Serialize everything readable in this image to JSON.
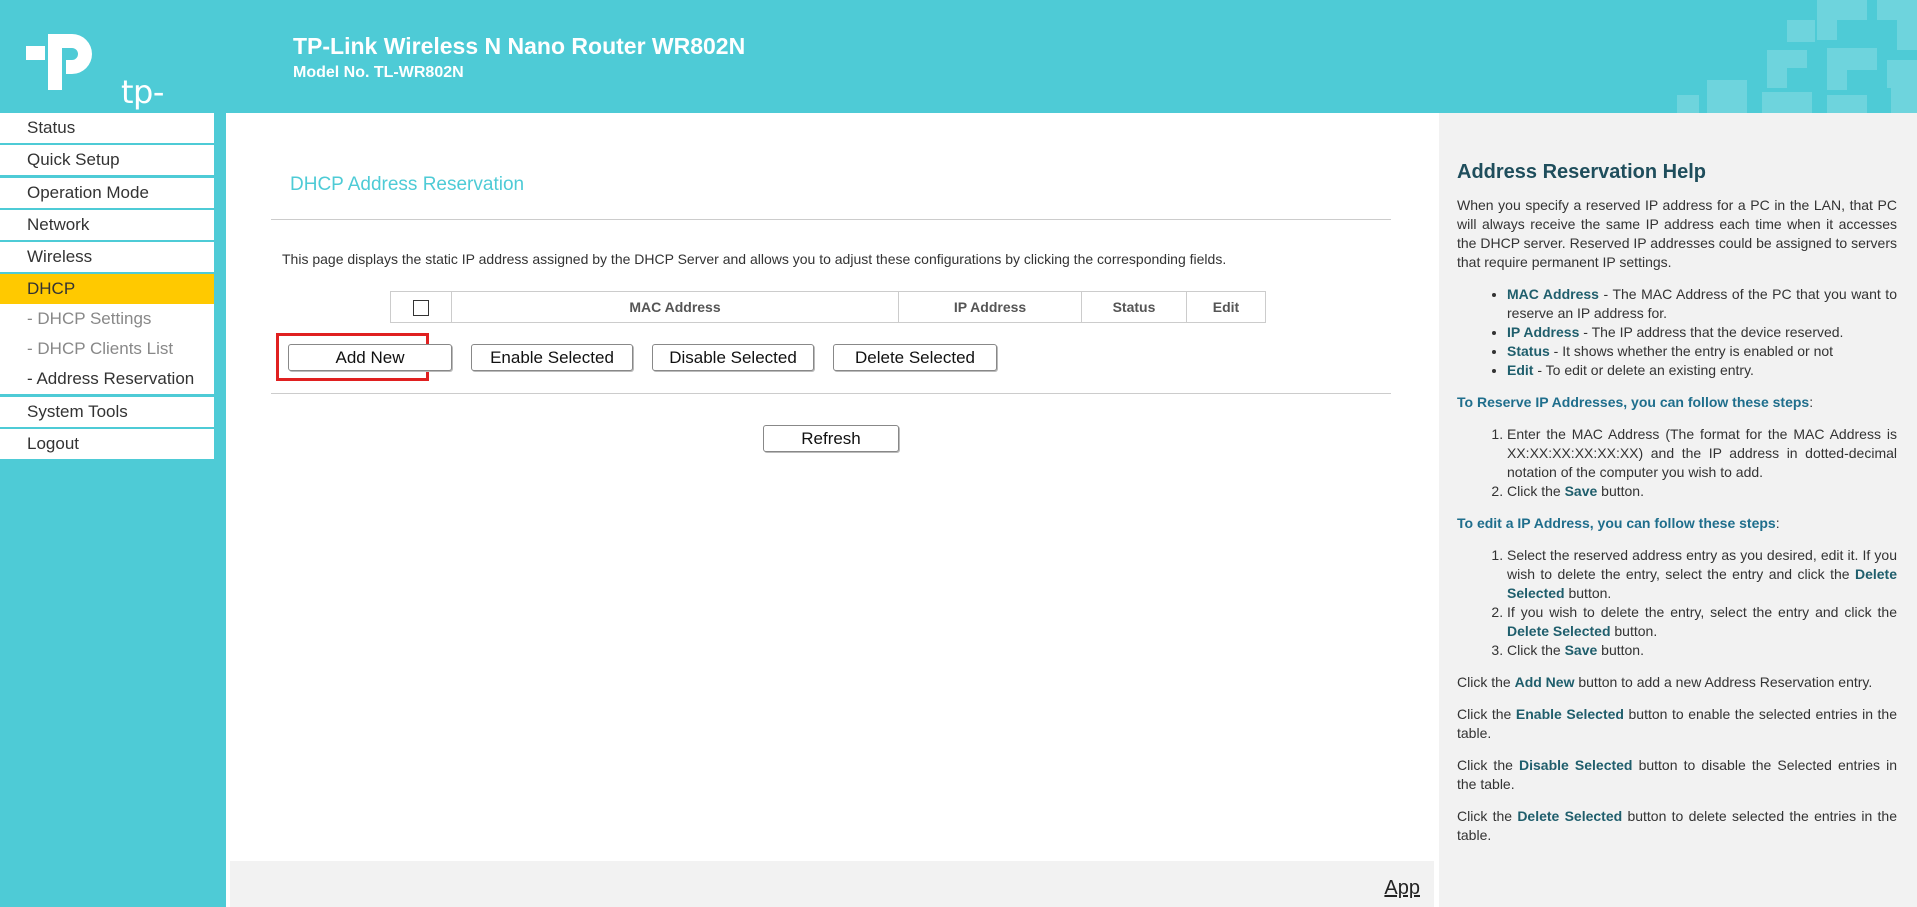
{
  "header": {
    "logo_text": "tp-link",
    "title": "TP-Link Wireless N Nano Router WR802N",
    "model": "Model No. TL-WR802N"
  },
  "menu": {
    "status": "Status",
    "quick_setup": "Quick Setup",
    "operation_mode": "Operation Mode",
    "network": "Network",
    "wireless": "Wireless",
    "dhcp": "DHCP",
    "dhcp_settings": "- DHCP Settings",
    "dhcp_clients_list": "- DHCP Clients List",
    "address_reservation": "- Address Reservation",
    "system_tools": "System Tools",
    "logout": "Logout"
  },
  "main": {
    "title": "DHCP Address Reservation",
    "description": "This page displays the static IP address assigned by the DHCP Server and allows you to adjust these configurations by clicking the corresponding fields.",
    "table_headers": {
      "mac": "MAC Address",
      "ip": "IP Address",
      "status": "Status",
      "edit": "Edit"
    },
    "buttons": {
      "add_new": "Add New",
      "enable_selected": "Enable Selected",
      "disable_selected": "Disable Selected",
      "delete_selected": "Delete Selected",
      "refresh": "Refresh"
    },
    "footer_link": "App"
  },
  "help": {
    "title": "Address Reservation Help",
    "intro": "When you specify a reserved IP address for a PC in the LAN, that PC will always receive the same IP address each time when it accesses the DHCP server. Reserved IP addresses could be assigned to servers that require permanent IP settings.",
    "fields": [
      {
        "term": "MAC Address",
        "text": " - The MAC Address of the PC that you want to reserve an IP address for."
      },
      {
        "term": "IP Address",
        "text": " - The IP address that the device reserved."
      },
      {
        "term": "Status",
        "text": " - It shows whether the entry is enabled or not"
      },
      {
        "term": "Edit",
        "text": " - To edit or delete an existing entry."
      }
    ],
    "reserve_heading": "To Reserve IP Addresses, you can follow these steps",
    "reserve_steps": {
      "step1": "Enter the MAC Address (The format for the MAC Address is XX:XX:XX:XX:XX:XX) and the IP address in dotted-decimal notation of the computer you wish to add.",
      "step2_pre": "Click the ",
      "step2_term": "Save",
      "step2_post": " button."
    },
    "edit_heading": "To edit a IP Address, you can follow these steps",
    "edit_steps": {
      "step1_pre": "Select the reserved address entry as you desired, edit it. If you wish to delete the entry, select the entry and click the ",
      "step1_term": "Delete Selected",
      "step1_post": " button.",
      "step2_pre": "If you wish to delete the entry, select the entry and click the ",
      "step2_term": "Delete Selected",
      "step2_post": " button.",
      "step3_pre": "Click the ",
      "step3_term": "Save",
      "step3_post": " button."
    },
    "colon": ":",
    "click_the": "Click the ",
    "add_term": "Add New",
    "add_post": " button to add a new Address Reservation entry.",
    "enable_term": "Enable Selected",
    "enable_post": " button to enable the selected entries in the table.",
    "disable_term": "Disable Selected",
    "disable_post": " button to disable the Selected entries in the table.",
    "delete_term": "Delete Selected",
    "delete_post": " button to delete selected the entries in the table."
  },
  "colors": {
    "accent": "#4ecbd6",
    "active_menu": "#ffc900",
    "highlight": "#e02020"
  }
}
